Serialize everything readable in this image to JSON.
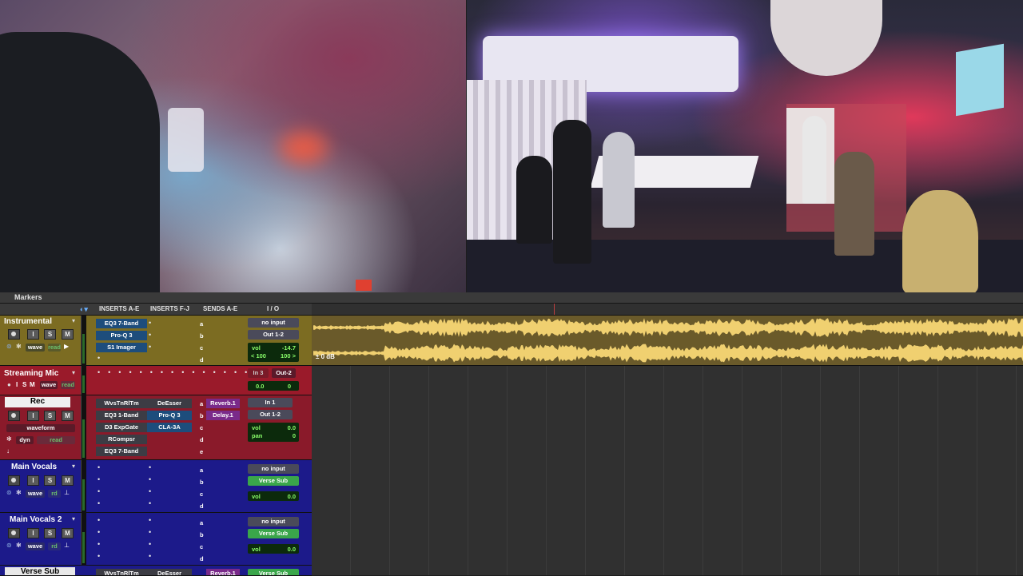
{
  "markers_label": "Markers",
  "header": {
    "inserts_ae": "INSERTS A-E",
    "inserts_fj": "INSERTS F-J",
    "sends_ae": "SENDS A-E",
    "io": "I / O"
  },
  "gain_label": "0 dB",
  "tracks": [
    {
      "name": "Instrumental",
      "color": "#8a7a2a",
      "buttons": [
        "I",
        "S",
        "M"
      ],
      "view": "wave",
      "mode": "read",
      "inserts_ae": [
        "EQ3 7-Band",
        "Pro-Q 3",
        "S1 Imager"
      ],
      "sends": [
        "a",
        "b",
        "c",
        "d"
      ],
      "input": "no input",
      "output": "Out 1-2",
      "vol": "-14.7",
      "pan_l": "100",
      "pan_r": "100",
      "vol_label": "vol",
      "pan_l_prefix": "< ",
      "pan_r_suffix": " >"
    },
    {
      "name": "Streaming Mic",
      "color": "#9a1a2a",
      "buttons": [
        "I",
        "S",
        "M"
      ],
      "view": "wave",
      "mode": "read",
      "input": "In 3",
      "output": "Out-2",
      "vol": "0.0",
      "pan": "0"
    },
    {
      "name": "Rec",
      "color": "#8a1a2a",
      "buttons": [
        "I",
        "S",
        "M"
      ],
      "view": "waveform",
      "mode": "read",
      "view2": "dyn",
      "inserts_ae": [
        "WvsTnRlTm",
        "EQ3 1-Band",
        "D3 ExpGate",
        "RCompsr",
        "EQ3 7-Band"
      ],
      "inserts_fj": [
        "DeEsser",
        "Pro-Q 3",
        "CLA-3A"
      ],
      "sends": [
        "Reverb.1",
        "Delay.1",
        "c",
        "d",
        "e"
      ],
      "send_letters": [
        "a",
        "b"
      ],
      "input": "In 1",
      "output": "Out 1-2",
      "vol": "0.0",
      "pan": "0",
      "vol_label": "vol",
      "pan_label": "pan"
    },
    {
      "name": "Main Vocals",
      "color": "#1c1a8a",
      "buttons": [
        "I",
        "S",
        "M"
      ],
      "view": "wave",
      "mode": "rd",
      "sends": [
        "a",
        "b",
        "c",
        "d"
      ],
      "input": "no input",
      "output": "Verse Sub",
      "vol": "0.0",
      "vol_label": "vol"
    },
    {
      "name": "Main Vocals 2",
      "color": "#1c1a8a",
      "buttons": [
        "I",
        "S",
        "M"
      ],
      "view": "wave",
      "mode": "rd",
      "sends": [
        "a",
        "b",
        "c",
        "d"
      ],
      "input": "no input",
      "output": "Verse Sub",
      "vol": "0.0",
      "vol_label": "vol"
    },
    {
      "name": "Verse Sub",
      "color": "#1c1a8a",
      "inserts_ae": [
        "WvsTnRlTm"
      ],
      "inserts_fj": [
        "DeEsser"
      ],
      "sends": [
        "Reverb.1"
      ],
      "output": "Verse Sub"
    }
  ]
}
